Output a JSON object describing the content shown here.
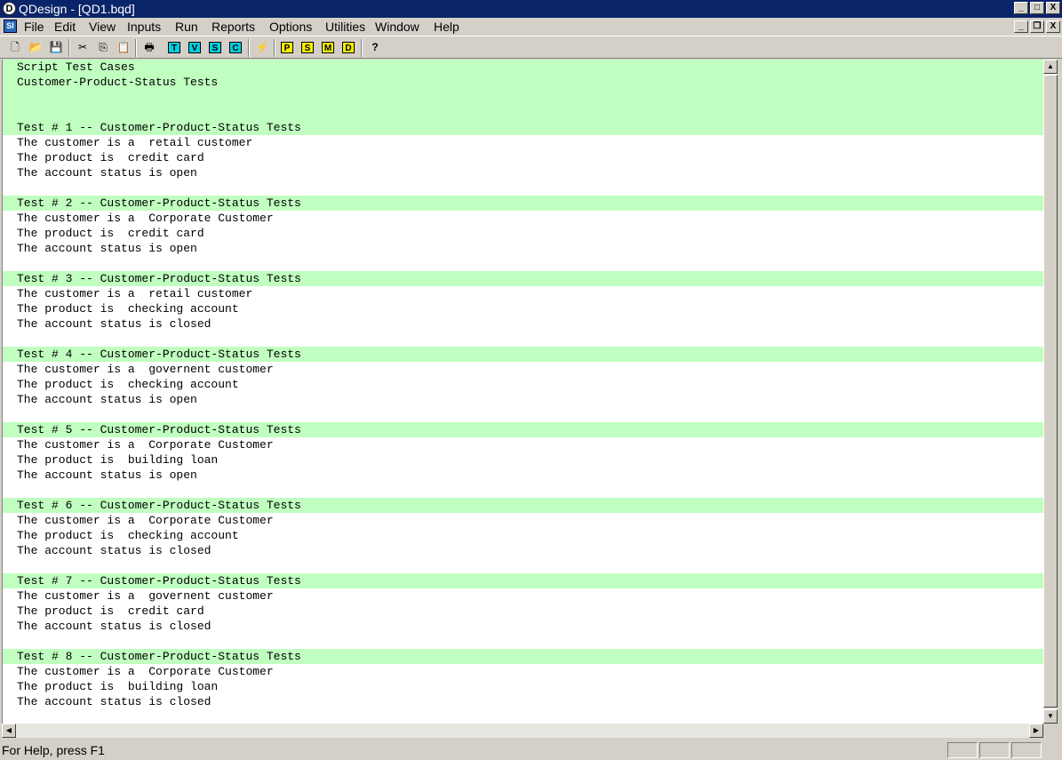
{
  "window": {
    "title": "QDesign - [QD1.bqd]",
    "app_icon_glyph": "D",
    "minimize_glyph": "_",
    "maximize_glyph": "□",
    "close_glyph": "X",
    "restore_glyph": "❐"
  },
  "menu": {
    "doc_icon_glyph": "SI",
    "items": [
      "File",
      "Edit",
      "View",
      "Inputs",
      "Run",
      "Reports",
      "Options",
      "Utilities",
      "Window",
      "Help"
    ]
  },
  "toolbar": {
    "glyphs": {
      "new": "🗋",
      "open": "📂",
      "save": "💾",
      "cut": "✂",
      "copy": "⎘",
      "paste": "📋",
      "print": "🖶",
      "run": "⚡",
      "help": "?"
    },
    "letters_cyan": [
      "T",
      "V",
      "S",
      "C"
    ],
    "letters_yellow": [
      "P",
      "S",
      "M",
      "D"
    ]
  },
  "editor": {
    "lines": [
      "Script Test Cases",
      "Customer-Product-Status Tests",
      "",
      "",
      "Test # 1 -- Customer-Product-Status Tests",
      "The customer is a  retail customer",
      "The product is  credit card",
      "The account status is open",
      "",
      "Test # 2 -- Customer-Product-Status Tests",
      "The customer is a  Corporate Customer",
      "The product is  credit card",
      "The account status is open",
      "",
      "Test # 3 -- Customer-Product-Status Tests",
      "The customer is a  retail customer",
      "The product is  checking account",
      "The account status is closed",
      "",
      "Test # 4 -- Customer-Product-Status Tests",
      "The customer is a  governent customer",
      "The product is  checking account",
      "The account status is open",
      "",
      "Test # 5 -- Customer-Product-Status Tests",
      "The customer is a  Corporate Customer",
      "The product is  building loan",
      "The account status is open",
      "",
      "Test # 6 -- Customer-Product-Status Tests",
      "The customer is a  Corporate Customer",
      "The product is  checking account",
      "The account status is closed",
      "",
      "Test # 7 -- Customer-Product-Status Tests",
      "The customer is a  governent customer",
      "The product is  credit card",
      "The account status is closed",
      "",
      "Test # 8 -- Customer-Product-Status Tests",
      "The customer is a  Corporate Customer",
      "The product is  building loan",
      "The account status is closed"
    ]
  },
  "scrollbars": {
    "up_glyph": "▲",
    "down_glyph": "▼",
    "left_glyph": "◀",
    "right_glyph": "▶"
  },
  "status": {
    "text": "For Help, press F1"
  },
  "colors": {
    "titlebar": "#0a246a",
    "highlight": "#c0ffc0",
    "chrome": "#d4d0c8"
  }
}
